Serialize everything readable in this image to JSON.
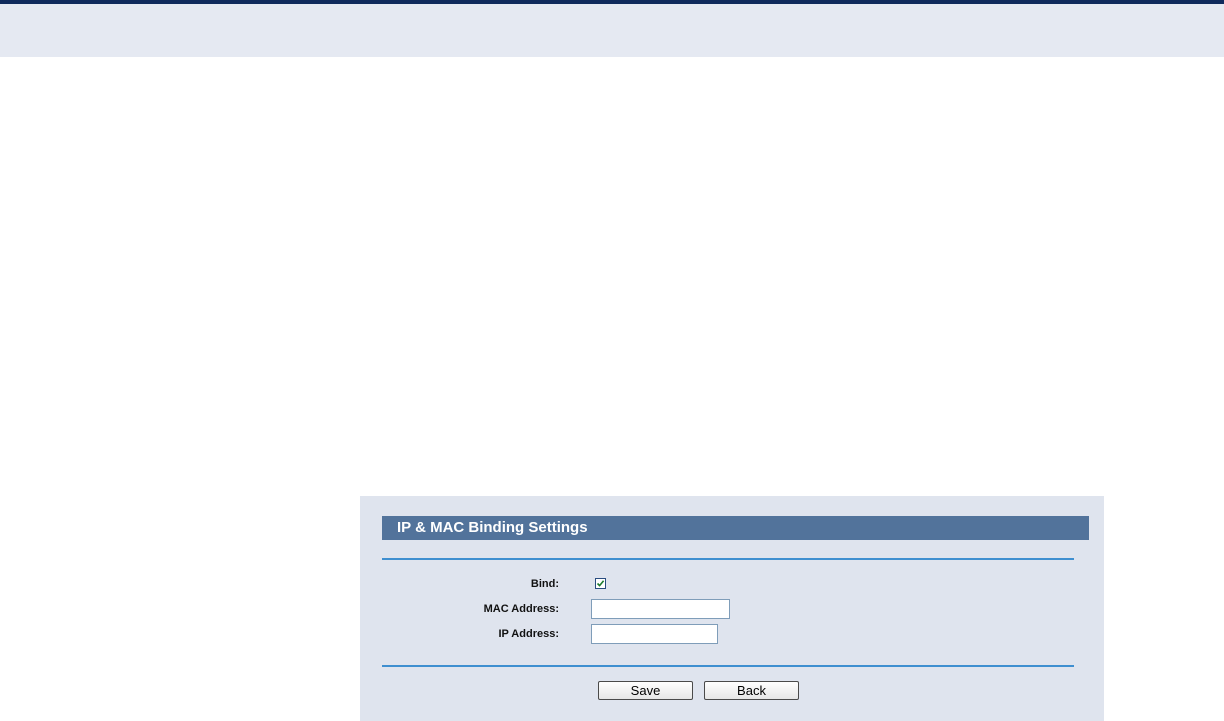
{
  "panel": {
    "title": "IP & MAC Binding Settings"
  },
  "form": {
    "bind_label": "Bind:",
    "bind_checked": true,
    "mac_label": "MAC Address:",
    "mac_value": "",
    "ip_label": "IP Address:",
    "ip_value": ""
  },
  "actions": {
    "save_label": "Save",
    "back_label": "Back"
  },
  "colors": {
    "header_rule": "#0f2a5c",
    "header_band": "#e5e9f2",
    "panel_bg": "#dfe4ee",
    "title_bar": "#52739b",
    "divider": "#3f8fd0",
    "check": "#1c7a2c"
  }
}
